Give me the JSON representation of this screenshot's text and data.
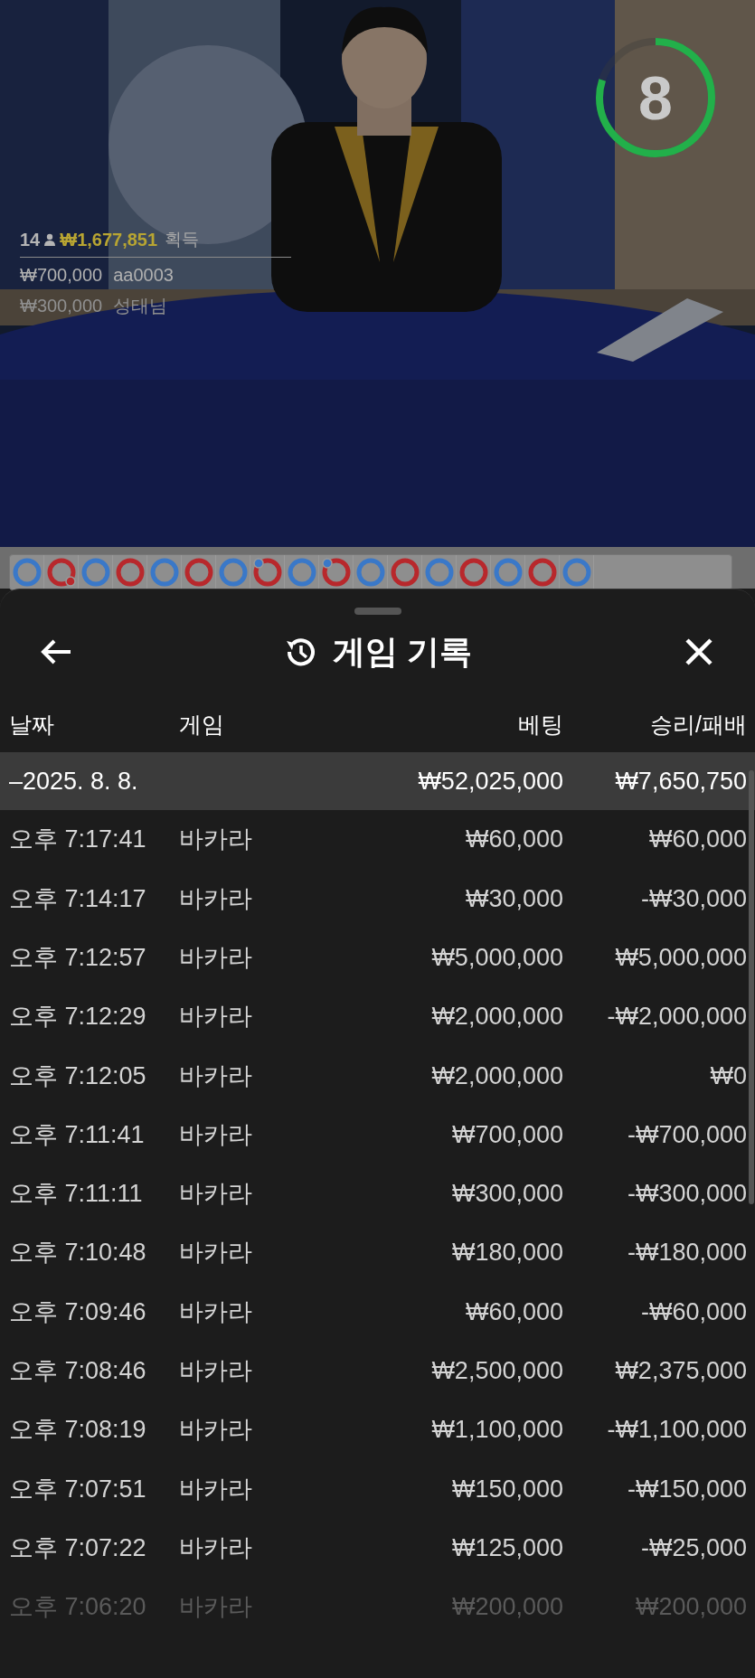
{
  "video": {
    "kind": "picture",
    "timer": {
      "value": "8",
      "level": 0.8
    },
    "winners": {
      "count": "14",
      "amount": "₩1,677,851",
      "suffix": "획득",
      "bets": [
        {
          "amount": "₩700,000",
          "name": "aa0003",
          "faded": false
        },
        {
          "amount": "₩300,000",
          "name": "성태님",
          "faded": true
        }
      ]
    }
  },
  "bead_road": [
    {
      "color": "#3a78c8",
      "player_pair": false,
      "banker_pair": false
    },
    {
      "color": "#b8282c",
      "player_pair": false,
      "banker_pair": true
    },
    {
      "color": "#3a78c8",
      "player_pair": false,
      "banker_pair": false
    },
    {
      "color": "#b8282c",
      "player_pair": false,
      "banker_pair": false
    },
    {
      "color": "#3a78c8",
      "player_pair": false,
      "banker_pair": false
    },
    {
      "color": "#b8282c",
      "player_pair": false,
      "banker_pair": false
    },
    {
      "color": "#3a78c8",
      "player_pair": false,
      "banker_pair": false
    },
    {
      "color": "#b8282c",
      "player_pair": true,
      "banker_pair": false
    },
    {
      "color": "#3a78c8",
      "player_pair": false,
      "banker_pair": false
    },
    {
      "color": "#b8282c",
      "player_pair": true,
      "banker_pair": false
    },
    {
      "color": "#3a78c8",
      "player_pair": false,
      "banker_pair": false
    },
    {
      "color": "#b8282c",
      "player_pair": false,
      "banker_pair": false
    },
    {
      "color": "#3a78c8",
      "player_pair": false,
      "banker_pair": false
    },
    {
      "color": "#b8282c",
      "player_pair": false,
      "banker_pair": false
    },
    {
      "color": "#3a78c8",
      "player_pair": false,
      "banker_pair": false
    },
    {
      "color": "#b8282c",
      "player_pair": false,
      "banker_pair": false
    },
    {
      "color": "#3a78c8",
      "player_pair": false,
      "banker_pair": false
    }
  ],
  "sheet": {
    "title": "게임 기록",
    "columns": [
      "날짜",
      "게임",
      "베팅",
      "승리/패배"
    ],
    "summary": {
      "date": "–2025. 8. 8.",
      "bet": "₩52,025,000",
      "result": "₩7,650,750"
    },
    "rows": [
      {
        "time": "오후 7:17:41",
        "game": "바카라",
        "bet": "₩60,000",
        "result": "₩60,000",
        "faded": false
      },
      {
        "time": "오후 7:14:17",
        "game": "바카라",
        "bet": "₩30,000",
        "result": "-₩30,000",
        "faded": false
      },
      {
        "time": "오후 7:12:57",
        "game": "바카라",
        "bet": "₩5,000,000",
        "result": "₩5,000,000",
        "faded": false
      },
      {
        "time": "오후 7:12:29",
        "game": "바카라",
        "bet": "₩2,000,000",
        "result": "-₩2,000,000",
        "faded": false
      },
      {
        "time": "오후 7:12:05",
        "game": "바카라",
        "bet": "₩2,000,000",
        "result": "₩0",
        "faded": false
      },
      {
        "time": "오후 7:11:41",
        "game": "바카라",
        "bet": "₩700,000",
        "result": "-₩700,000",
        "faded": false
      },
      {
        "time": "오후 7:11:11",
        "game": "바카라",
        "bet": "₩300,000",
        "result": "-₩300,000",
        "faded": false
      },
      {
        "time": "오후 7:10:48",
        "game": "바카라",
        "bet": "₩180,000",
        "result": "-₩180,000",
        "faded": false
      },
      {
        "time": "오후 7:09:46",
        "game": "바카라",
        "bet": "₩60,000",
        "result": "-₩60,000",
        "faded": false
      },
      {
        "time": "오후 7:08:46",
        "game": "바카라",
        "bet": "₩2,500,000",
        "result": "₩2,375,000",
        "faded": false
      },
      {
        "time": "오후 7:08:19",
        "game": "바카라",
        "bet": "₩1,100,000",
        "result": "-₩1,100,000",
        "faded": false
      },
      {
        "time": "오후 7:07:51",
        "game": "바카라",
        "bet": "₩150,000",
        "result": "-₩150,000",
        "faded": false
      },
      {
        "time": "오후 7:07:22",
        "game": "바카라",
        "bet": "₩125,000",
        "result": "-₩25,000",
        "faded": false
      },
      {
        "time": "오후 7:06:20",
        "game": "바카라",
        "bet": "₩200,000",
        "result": "₩200,000",
        "faded": true
      }
    ]
  }
}
